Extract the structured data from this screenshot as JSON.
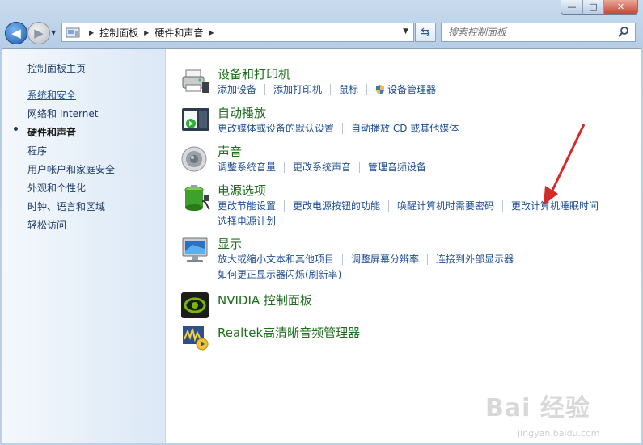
{
  "window": {
    "minimize": "—",
    "maximize": "□",
    "close": "✕"
  },
  "nav": {
    "breadcrumbs": [
      "控制面板",
      "硬件和声音"
    ],
    "search_placeholder": "搜索控制面板"
  },
  "sidebar": {
    "items": [
      {
        "label": "控制面板主页",
        "state": "normal"
      },
      {
        "label": "系统和安全",
        "state": "link"
      },
      {
        "label": "网络和 Internet",
        "state": "normal"
      },
      {
        "label": "硬件和声音",
        "state": "current"
      },
      {
        "label": "程序",
        "state": "normal"
      },
      {
        "label": "用户帐户和家庭安全",
        "state": "normal"
      },
      {
        "label": "外观和个性化",
        "state": "normal"
      },
      {
        "label": "时钟、语言和区域",
        "state": "normal"
      },
      {
        "label": "轻松访问",
        "state": "normal"
      }
    ]
  },
  "categories": {
    "devices": {
      "title": "设备和打印机",
      "links": [
        "添加设备",
        "添加打印机",
        "鼠标",
        "设备管理器"
      ]
    },
    "autoplay": {
      "title": "自动播放",
      "links": [
        "更改媒体或设备的默认设置",
        "自动播放 CD 或其他媒体"
      ]
    },
    "sound": {
      "title": "声音",
      "links": [
        "调整系统音量",
        "更改系统声音",
        "管理音频设备"
      ]
    },
    "power": {
      "title": "电源选项",
      "links": [
        "更改节能设置",
        "更改电源按钮的功能",
        "唤醒计算机时需要密码",
        "更改计算机睡眠时间"
      ],
      "links2": [
        "选择电源计划"
      ]
    },
    "display": {
      "title": "显示",
      "links": [
        "放大或缩小文本和其他项目",
        "调整屏幕分辨率",
        "连接到外部显示器"
      ],
      "links2": [
        "如何更正显示器闪烁(刷新率)"
      ]
    },
    "nvidia": {
      "title": "NVIDIA 控制面板"
    },
    "realtek": {
      "title": "Realtek高清晰音频管理器"
    }
  },
  "watermark": {
    "text": "Bai 经验",
    "url": "jingyan.baidu.com"
  },
  "colors": {
    "accent_green": "#1e6e1e",
    "link_blue": "#1e4e94",
    "annotation_red": "#d42a2a"
  }
}
